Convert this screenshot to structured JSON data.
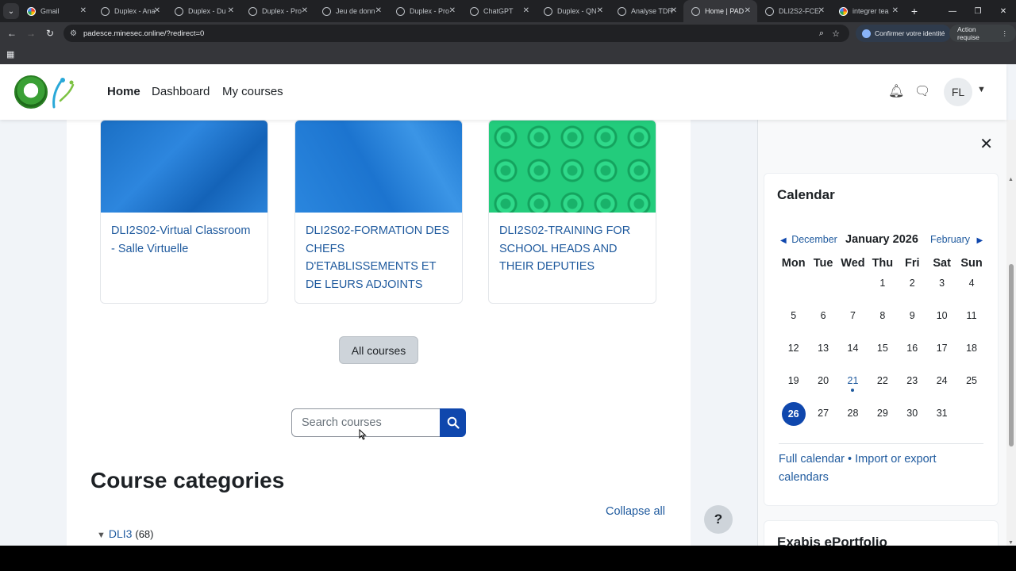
{
  "browser": {
    "tabs": [
      {
        "label": "Gmail",
        "icon": "google-icon",
        "active": false
      },
      {
        "label": "Duplex - Ana",
        "icon": "globe-icon",
        "active": false
      },
      {
        "label": "Duplex - Du",
        "icon": "globe-icon",
        "active": false
      },
      {
        "label": "Duplex - Pro",
        "icon": "globe-icon",
        "active": false
      },
      {
        "label": "Jeu de donn",
        "icon": "globe-icon",
        "active": false
      },
      {
        "label": "Duplex - Pro",
        "icon": "globe-icon",
        "active": false
      },
      {
        "label": "ChatGPT",
        "icon": "chatgpt-icon",
        "active": false
      },
      {
        "label": "Duplex - QN",
        "icon": "globe-icon",
        "active": false
      },
      {
        "label": "Analyse TDR",
        "icon": "globe-icon",
        "active": false
      },
      {
        "label": "Home | PAD",
        "icon": "padesce-icon",
        "active": true
      },
      {
        "label": "DLI2S2-FCE/",
        "icon": "globe-icon",
        "active": false
      },
      {
        "label": "integrer tea",
        "icon": "google-icon",
        "active": false
      }
    ],
    "url": "padesce.minesec.online/?redirect=0",
    "identity_label": "Confirmer votre identité",
    "action_label": "Action requise"
  },
  "navbar": {
    "links": [
      {
        "label": "Home",
        "active": true
      },
      {
        "label": "Dashboard",
        "active": false
      },
      {
        "label": "My courses",
        "active": false
      }
    ],
    "user_initials": "FL"
  },
  "courses": [
    {
      "title": "DLI2S02-Virtual Classroom - Salle Virtuelle",
      "pattern": "blue"
    },
    {
      "title": "DLI2S02-FORMATION DES CHEFS D'ETABLISSEMENTS ET DE LEURS ADJOINTS",
      "pattern": "blue"
    },
    {
      "title": "DLI2S02-TRAINING FOR SCHOOL HEADS AND THEIR DEPUTIES",
      "pattern": "green"
    }
  ],
  "all_courses_label": "All courses",
  "search": {
    "placeholder": "Search courses"
  },
  "categories": {
    "heading": "Course categories",
    "collapse_label": "Collapse all",
    "items": [
      {
        "name": "DLI3",
        "count": "(68)"
      }
    ]
  },
  "help_label": "?",
  "calendar": {
    "title": "Calendar",
    "prev_month": "December",
    "month": "January 2026",
    "next_month": "February",
    "weekdays": [
      "Mon",
      "Tue",
      "Wed",
      "Thu",
      "Fri",
      "Sat",
      "Sun"
    ],
    "weeks": [
      [
        "",
        "",
        "",
        "1",
        "2",
        "3",
        "4"
      ],
      [
        "5",
        "6",
        "7",
        "8",
        "9",
        "10",
        "11"
      ],
      [
        "12",
        "13",
        "14",
        "15",
        "16",
        "17",
        "18"
      ],
      [
        "19",
        "20",
        "21",
        "22",
        "23",
        "24",
        "25"
      ],
      [
        "26",
        "27",
        "28",
        "29",
        "30",
        "31",
        ""
      ]
    ],
    "marked_day": "21",
    "selected_day": "26",
    "footer_full": "Full calendar",
    "footer_sep": " • ",
    "footer_export": "Import or export calendars"
  },
  "exabis_title": "Exabis ePortfolio",
  "colors": {
    "primary": "#0f47ad",
    "link": "#1f5a9e"
  }
}
